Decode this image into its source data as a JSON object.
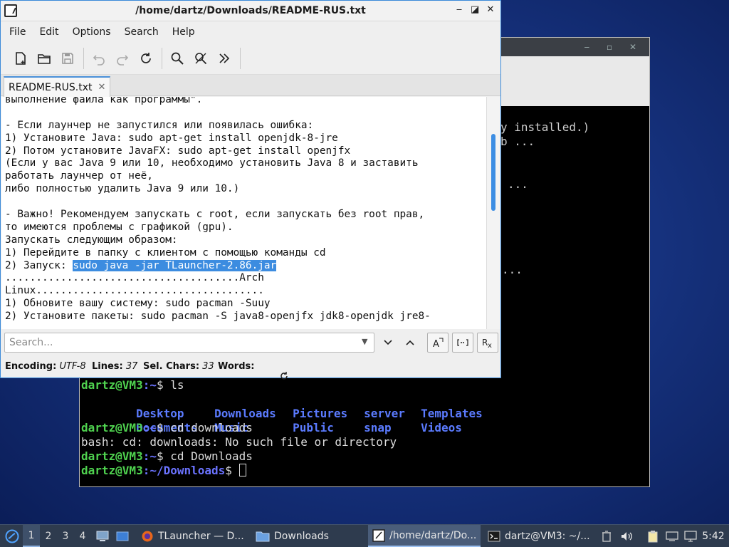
{
  "terminal": {
    "partial_lines": [
      {
        "text": "y installed.)"
      },
      {
        "text": "b ..."
      },
      {
        "text": "..."
      },
      {
        "text": "..."
      }
    ],
    "prompt_user": "dartz@VM3",
    "ls_cmd": {
      "path": ":~",
      "cmd": "$ ls"
    },
    "ls_output": [
      [
        "Desktop",
        "Downloads",
        "Pictures",
        "server",
        "Templates"
      ],
      [
        "Documents",
        "Music",
        "Public",
        "snap",
        "Videos"
      ]
    ],
    "cmd1": {
      "path": ":~",
      "cmd": "$ cd downloads"
    },
    "error_line": "bash: cd: downloads: No such file or directory",
    "cmd2": {
      "path": ":~",
      "cmd": "$ cd Downloads"
    },
    "cmd3": {
      "path": ":~/Downloads",
      "cmd": "$ "
    }
  },
  "editor": {
    "title": "/home/dartz/Downloads/README-RUS.txt",
    "menu": [
      "File",
      "Edit",
      "Options",
      "Search",
      "Help"
    ],
    "tab_label": "README-RUS.txt",
    "lines": [
      "выполнение файла как программы\".",
      "",
      "- Если лаунчер не запустился или появилась ошибка:",
      "1) Установите Java: sudo apt-get install openjdk-8-jre",
      "2) Потом установите JavaFX: sudo apt-get install openjfx",
      "(Если у вас Java 9 или 10, необходимо установить Java 8 и заставить",
      "работать лаунчер от неё,",
      "либо полностью удалить Java 9 или 10.)",
      "",
      "- Важно! Рекомендуем запускать с root, если запускать без root прав,",
      "то имеются проблемы с графикой (gpu).",
      "Запускать следующим образом:",
      "1) Перейдите в папку с клиентом с помощью команды cd"
    ],
    "launch_prefix": "2) Запуск: ",
    "launch_selected": "sudo java -jar TLauncher-2.86.jar",
    "lines_after": [
      "......................................Arch",
      "Linux.....................................",
      "1) Обновите вашу систему: sudo pacman -Suuy",
      "2) Установите пакеты: sudo pacman -S java8-openjfx jdk8-openjdk jre8-"
    ],
    "search_placeholder": "Search...",
    "status": {
      "encoding_label": "Encoding:",
      "encoding_value": "UTF-8",
      "lines_label": "Lines:",
      "lines_value": "37",
      "selchars_label": "Sel. Chars:",
      "selchars_value": "33",
      "words_label": "Words:"
    }
  },
  "taskbar": {
    "workspaces": [
      "1",
      "2",
      "3",
      "4"
    ],
    "tasks": [
      {
        "label": "TLauncher — D..."
      },
      {
        "label": "Downloads"
      },
      {
        "label": "/home/dartz/Do..."
      },
      {
        "label": "dartz@VM3: ~/..."
      }
    ],
    "clock": "5:42"
  },
  "colors": {
    "accent": "#3c8ce0",
    "prompt_green": "#4fd24f",
    "dir_blue": "#5b7bff"
  }
}
